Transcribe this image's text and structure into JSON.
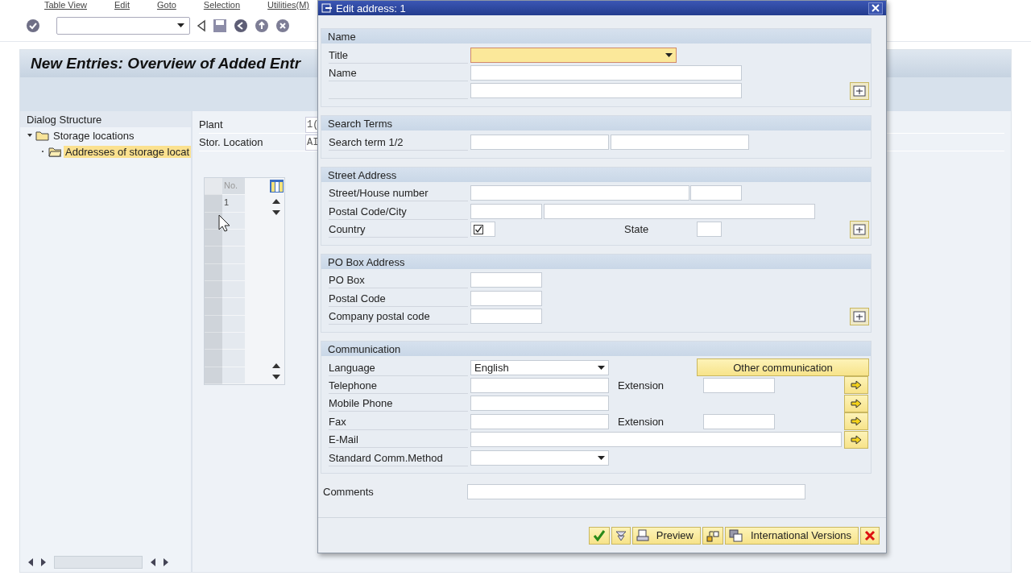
{
  "menu": [
    "Table View",
    "Edit",
    "Goto",
    "Selection",
    "Utilities(M)"
  ],
  "screen_title": "New Entries: Overview of Added Entr",
  "dialog_structure": {
    "title": "Dialog Structure",
    "items": [
      {
        "label": "Storage locations",
        "selected": false,
        "expanded": true,
        "children": [
          {
            "label": "Addresses of storage locat",
            "selected": true
          }
        ]
      }
    ]
  },
  "header_fields": [
    {
      "label": "Plant",
      "value": "1("
    },
    {
      "label": "Stor. Location",
      "value": "AI"
    }
  ],
  "table": {
    "columns": [
      "No."
    ],
    "rows": [
      [
        "1"
      ]
    ]
  },
  "dialog": {
    "title": "Edit address:  1",
    "sections": [
      {
        "title": "Name",
        "rows": [
          {
            "label": "Title",
            "items": [
              {
                "kind": "dropdown",
                "focused": true
              }
            ]
          },
          {
            "label": "Name",
            "items": [
              {
                "kind": "input"
              }
            ]
          },
          {
            "items": [
              {
                "kind": "input"
              },
              {
                "kind": "expand"
              }
            ]
          }
        ]
      },
      {
        "title": "Search Terms",
        "rows": [
          {
            "label": "Search term 1/2",
            "items": [
              {
                "kind": "input"
              },
              {
                "kind": "input"
              }
            ]
          }
        ]
      },
      {
        "title": "Street Address",
        "rows": [
          {
            "label": "Street/House number",
            "items": [
              {
                "kind": "input"
              },
              {
                "kind": "input"
              }
            ]
          },
          {
            "label": "Postal Code/City",
            "items": [
              {
                "kind": "input"
              },
              {
                "kind": "input"
              }
            ]
          },
          {
            "label": "Country",
            "items": [
              {
                "kind": "check",
                "checked": true
              },
              {
                "kind": "label",
                "text": "State"
              },
              {
                "kind": "input"
              },
              {
                "kind": "expand"
              }
            ]
          }
        ]
      },
      {
        "title": "PO Box Address",
        "rows": [
          {
            "label": "PO Box",
            "items": [
              {
                "kind": "input"
              }
            ]
          },
          {
            "label": "Postal Code",
            "items": [
              {
                "kind": "input"
              }
            ]
          },
          {
            "label": "Company postal code",
            "items": [
              {
                "kind": "input"
              },
              {
                "kind": "expand"
              }
            ]
          }
        ]
      },
      {
        "title": "Communication",
        "rows": [
          {
            "label": "Language",
            "items": [
              {
                "kind": "dropdown",
                "value": "English"
              },
              {
                "kind": "button",
                "text": "Other communication"
              }
            ]
          },
          {
            "label": "Telephone",
            "items": [
              {
                "kind": "input"
              },
              {
                "kind": "label",
                "text": "Extension"
              },
              {
                "kind": "input"
              },
              {
                "kind": "arrow"
              }
            ]
          },
          {
            "label": "Mobile Phone",
            "items": [
              {
                "kind": "input"
              },
              {
                "kind": "arrow"
              }
            ]
          },
          {
            "label": "Fax",
            "items": [
              {
                "kind": "input"
              },
              {
                "kind": "label",
                "text": "Extension"
              },
              {
                "kind": "input"
              },
              {
                "kind": "arrow"
              }
            ]
          },
          {
            "label": "E-Mail",
            "items": [
              {
                "kind": "input"
              },
              {
                "kind": "arrow"
              }
            ]
          },
          {
            "label": "Standard Comm.Method",
            "items": [
              {
                "kind": "dropdown"
              }
            ]
          }
        ]
      }
    ],
    "comments": {
      "label": "Comments"
    },
    "buttons": [
      {
        "kind": "confirm"
      },
      {
        "kind": "filter"
      },
      {
        "kind": "preview",
        "text": "Preview"
      },
      {
        "kind": "transport"
      },
      {
        "kind": "versions",
        "text": "International Versions"
      },
      {
        "kind": "cancel"
      }
    ]
  }
}
